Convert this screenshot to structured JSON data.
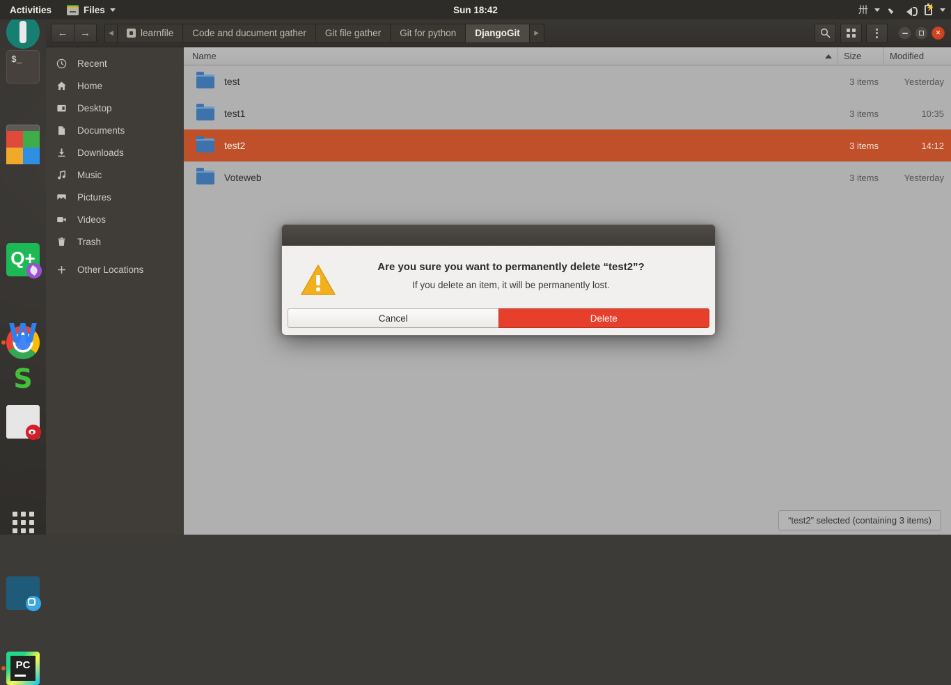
{
  "top_panel": {
    "activities": "Activities",
    "app_menu": "Files",
    "clock": "Sun 18:42",
    "tray": {
      "ibus": "中",
      "icons": [
        "ibus-icon",
        "chevron-down-icon",
        "wifi-icon",
        "volume-icon",
        "battery-icon",
        "chevron-down-icon"
      ]
    }
  },
  "dock": {
    "items": [
      {
        "name": "system-settings",
        "running": false
      },
      {
        "name": "terminal",
        "running": false,
        "label": "$_"
      },
      {
        "name": "files",
        "running": true,
        "active": true
      },
      {
        "name": "ms-office",
        "running": false
      },
      {
        "name": "qq",
        "running": false,
        "label": "Q+"
      },
      {
        "name": "chrome",
        "running": true
      },
      {
        "name": "document-viewer",
        "running": false
      },
      {
        "name": "wps-writer",
        "running": false,
        "label": "W"
      },
      {
        "name": "wps-spreadsheet",
        "running": false,
        "label": "S"
      },
      {
        "name": "screenshot",
        "running": false
      },
      {
        "name": "pycharm",
        "running": true,
        "label": "PC"
      },
      {
        "name": "show-applications",
        "running": false
      }
    ]
  },
  "headerbar": {
    "back": "←",
    "forward": "→",
    "crumb_left": "◀",
    "crumb_right": "▶",
    "breadcrumbs": [
      {
        "label": "learnfile",
        "current": false,
        "has_icon": true
      },
      {
        "label": "Code and ducument gather",
        "current": false,
        "has_icon": false
      },
      {
        "label": "Git file gather",
        "current": false,
        "has_icon": false
      },
      {
        "label": "Git for python",
        "current": false,
        "has_icon": false
      },
      {
        "label": "DjangoGit",
        "current": true,
        "has_icon": false
      }
    ],
    "buttons": [
      "search-icon",
      "view-grid-icon",
      "menu-dots-icon"
    ],
    "window_controls": [
      "minimize",
      "maximize",
      "close"
    ]
  },
  "sidebar": {
    "items": [
      {
        "label": "Recent",
        "icon": "clock-icon"
      },
      {
        "label": "Home",
        "icon": "home-icon"
      },
      {
        "label": "Desktop",
        "icon": "desktop-icon"
      },
      {
        "label": "Documents",
        "icon": "document-icon"
      },
      {
        "label": "Downloads",
        "icon": "download-icon"
      },
      {
        "label": "Music",
        "icon": "music-icon"
      },
      {
        "label": "Pictures",
        "icon": "picture-icon"
      },
      {
        "label": "Videos",
        "icon": "video-icon"
      },
      {
        "label": "Trash",
        "icon": "trash-icon"
      },
      {
        "label": "Other Locations",
        "icon": "plus-icon"
      }
    ]
  },
  "file_list": {
    "columns": {
      "name": "Name",
      "size": "Size",
      "modified": "Modified"
    },
    "sort": "ascending",
    "rows": [
      {
        "name": "test",
        "size": "3 items",
        "modified": "Yesterday",
        "selected": false
      },
      {
        "name": "test1",
        "size": "3 items",
        "modified": "10:35",
        "selected": false
      },
      {
        "name": "test2",
        "size": "3 items",
        "modified": "14:12",
        "selected": true
      },
      {
        "name": "Voteweb",
        "size": "3 items",
        "modified": "Yesterday",
        "selected": false
      }
    ]
  },
  "status_bar": {
    "text": "“test2” selected  (containing 3 items)"
  },
  "dialog": {
    "icon": "warning-icon",
    "heading": "Are you sure you want to permanently delete “test2”?",
    "subtext": "If you delete an item, it will be permanently lost.",
    "cancel_label": "Cancel",
    "delete_label": "Delete"
  },
  "colors": {
    "selection_orange": "#c0502a",
    "delete_red": "#e6402c",
    "panel_dark": "#2e2c29",
    "fileview_bg": "#b0b0b0",
    "folder_blue": "#3d72ab"
  }
}
